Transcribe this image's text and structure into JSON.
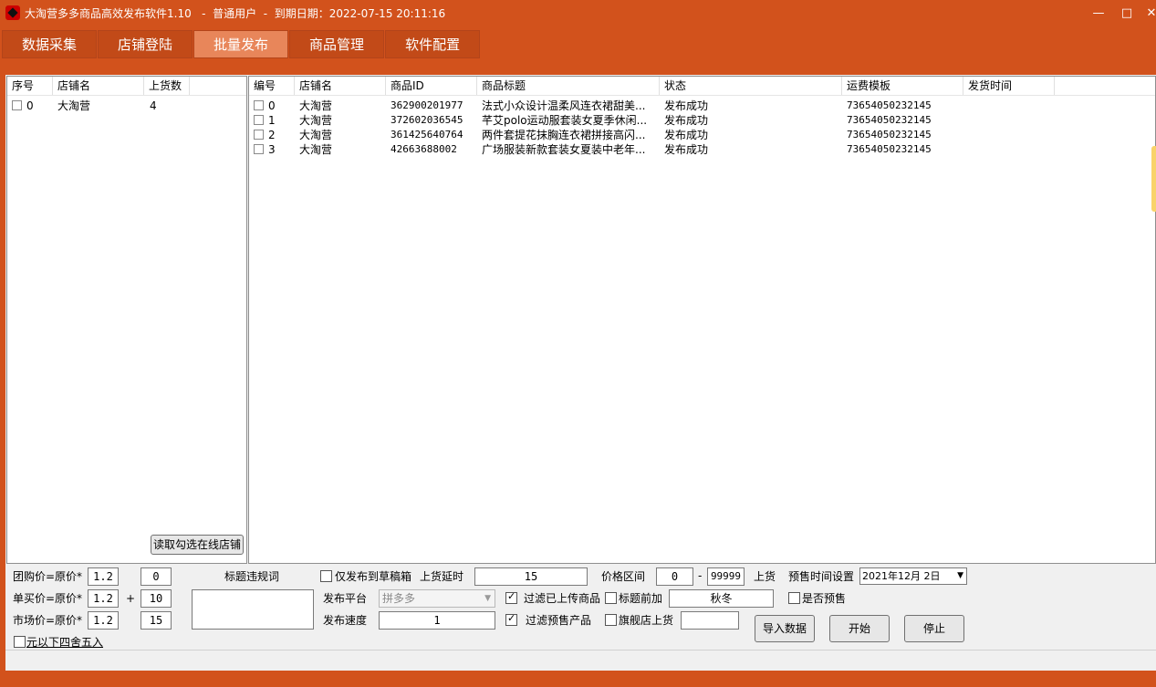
{
  "titlebar": {
    "title": "大淘营多多商品高效发布软件1.10   -  普通用户  -  到期日期：2022-07-15 20:11:16",
    "minimize": "—",
    "maximize": "□",
    "close": "✕"
  },
  "tabs": [
    {
      "label": "数据采集",
      "active": false
    },
    {
      "label": "店铺登陆",
      "active": false
    },
    {
      "label": "批量发布",
      "active": true
    },
    {
      "label": "商品管理",
      "active": false
    },
    {
      "label": "软件配置",
      "active": false
    }
  ],
  "shop_list": {
    "columns": [
      "序号",
      "店铺名",
      "上货数"
    ],
    "rows": [
      {
        "index": "0",
        "shop": "大淘营",
        "count": "4"
      }
    ],
    "read_button": "读取勾选在线店铺"
  },
  "product_list": {
    "columns": [
      "编号",
      "店铺名",
      "商品ID",
      "商品标题",
      "状态",
      "运费模板",
      "发货时间"
    ],
    "rows": [
      {
        "index": "0",
        "shop": "大淘营",
        "id": "362900201977",
        "title": "法式小众设计温柔风连衣裙甜美...",
        "status": "发布成功",
        "template": "73654050232145",
        "ship_time": ""
      },
      {
        "index": "1",
        "shop": "大淘营",
        "id": "372602036545",
        "title": "芊艾polo运动服套装女夏季休闲...",
        "status": "发布成功",
        "template": "73654050232145",
        "ship_time": ""
      },
      {
        "index": "2",
        "shop": "大淘营",
        "id": "361425640764",
        "title": "两件套提花抹胸连衣裙拼接高闪...",
        "status": "发布成功",
        "template": "73654050232145",
        "ship_time": ""
      },
      {
        "index": "3",
        "shop": "大淘营",
        "id": "42663688002",
        "title": "广场服装新款套装女夏装中老年...",
        "status": "发布成功",
        "template": "73654050232145",
        "ship_time": ""
      }
    ]
  },
  "pricing": {
    "group_label": "团购价=原价*",
    "group_mult": "1.2",
    "group_add": "0",
    "single_label": "单买价=原价*",
    "single_mult": "1.2",
    "single_plus": "+",
    "single_add": "10",
    "market_label": "市场价=原价*",
    "market_mult": "1.2",
    "market_add": "15",
    "round_label": "元以下四舍五入"
  },
  "settings": {
    "violation_label": "标题违规词",
    "draft_only_label": "仅发布到草稿箱",
    "delay_label": "上货延时",
    "delay_value": "15",
    "price_range_label": "价格区间",
    "price_min": "0",
    "price_dash": "-",
    "price_max": "99999",
    "upload_label": "上货",
    "presale_time_label": "预售时间设置",
    "presale_date": "2021年12月 2日",
    "platform_label": "发布平台",
    "platform_value": "拼多多",
    "filter_uploaded_label": "过滤已上传商品",
    "title_prefix_label": "标题前加",
    "title_prefix_value": "秋冬",
    "is_presale_label": "是否预售",
    "speed_label": "发布速度",
    "speed_value": "1",
    "filter_presale_label": "过滤预售产品",
    "flagship_label": "旗舰店上货",
    "flagship_value": ""
  },
  "actions": {
    "import": "导入数据",
    "start": "开始",
    "stop": "停止"
  }
}
